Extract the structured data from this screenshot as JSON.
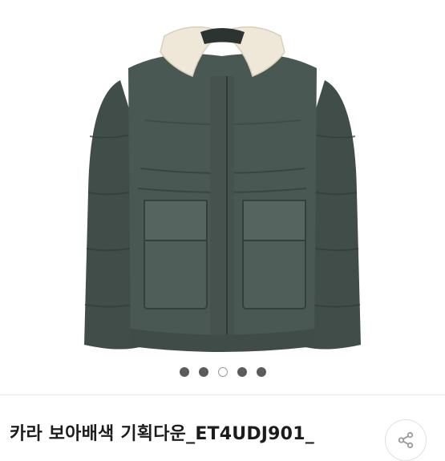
{
  "product": {
    "title": "카라 보아배색 기획다운_ET4UDJ901_",
    "image_icon": "padded-jacket-image"
  },
  "gallery": {
    "image_count": 5,
    "active_index": 2
  },
  "share": {
    "icon": "share-icon"
  },
  "colors": {
    "jacket": "#46544f",
    "collar": "#efe8d8",
    "dot": "#5b5b5b",
    "dot_active": "#ffffff"
  }
}
